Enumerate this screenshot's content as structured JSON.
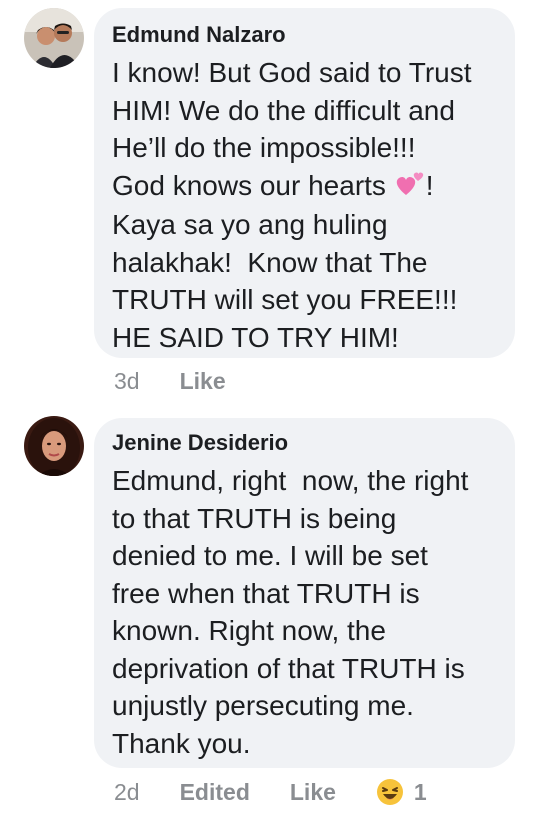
{
  "comments": [
    {
      "author": "Edmund Nalzaro",
      "lines": [
        "I know! But God said to Trust",
        "HIM! We do the difficult and",
        "He’ll do the impossible!!!",
        "God knows our hearts",
        "Kaya sa yo ang huling",
        "halakhak!  Know that The",
        "TRUTH will set you FREE!!!",
        "HE SAID TO TRY HIM!"
      ],
      "line4_suffix": "!",
      "inline_emoji": "two-hearts-icon",
      "time": "3d",
      "like_label": "Like"
    },
    {
      "author": "Jenine Desiderio",
      "lines": [
        "Edmund, right  now, the right",
        "to that TRUTH is being",
        "denied to me. I will be set",
        "free when that TRUTH is",
        "known. Right now, the",
        "deprivation of that TRUTH is",
        "unjustly persecuting me.",
        "Thank you."
      ],
      "time": "2d",
      "edited_label": "Edited",
      "like_label": "Like",
      "reaction_icon": "laughing-face-icon",
      "reaction_count": "1"
    }
  ],
  "colors": {
    "bubble": "#f0f2f5",
    "meta": "#8a8d91",
    "text": "#1c1e21"
  }
}
